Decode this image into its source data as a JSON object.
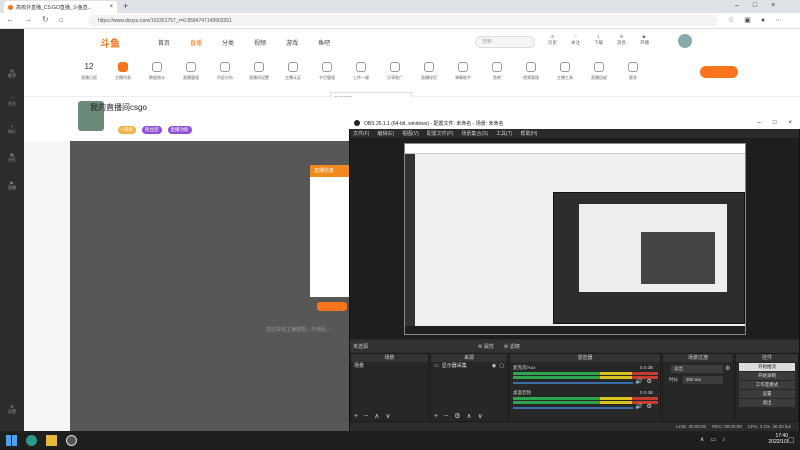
{
  "browser": {
    "tab_title": "高校外直播_CS:GO直播_斗鱼直...",
    "url": "https://www.douyu.com/102351757_r=0.8584747149903261",
    "new_tab": "+"
  },
  "site": {
    "logo": "斗鱼",
    "nav": [
      "首页",
      "直播",
      "分类",
      "视频",
      "游戏",
      "鱼吧"
    ],
    "search_placeholder": "搜索",
    "user_links": [
      "历史",
      "关注",
      "下载",
      "消息",
      "开播"
    ],
    "categories": [
      {
        "label": "直播日程",
        "badge": "12"
      },
      {
        "label": "主播列表"
      },
      {
        "label": "数据统计"
      },
      {
        "label": "直播管理"
      },
      {
        "label": "内容分析"
      },
      {
        "label": "直播间设置"
      },
      {
        "label": "主播认证"
      },
      {
        "label": "节目管理"
      },
      {
        "label": "上传一键"
      },
      {
        "label": "分享推广"
      },
      {
        "label": "直播伴侣"
      },
      {
        "label": "弹幕助手"
      },
      {
        "label": "鱼吧"
      },
      {
        "label": "视频管理"
      },
      {
        "label": "主播工具"
      },
      {
        "label": "直播回放"
      },
      {
        "label": "更多"
      }
    ],
    "notice": "开播提醒",
    "room_title": "我的直播间csgo",
    "room_badges": [
      "V等级",
      "粉丝团",
      "直播功能"
    ],
    "dialog_title": "直播信息",
    "footer_text": "您还没有主播权限，开通后..."
  },
  "sidebar": [
    "推荐",
    "关注",
    "排行",
    "分区",
    "直播",
    "设置"
  ],
  "obs": {
    "title": "OBS 26.1.1 (64-bit, windows) - 配置文件: 未命名 - 场景: 未命名",
    "menu": [
      "文件(F)",
      "编辑(E)",
      "视图(V)",
      "配置文件(P)",
      "场景集合(S)",
      "工具(T)",
      "帮助(H)"
    ],
    "scene_bar_label": "未选源",
    "scene_bar_buttons": [
      "属性",
      "滤镜"
    ],
    "docks": {
      "scenes": {
        "title": "场景",
        "items": [
          "场景"
        ]
      },
      "sources": {
        "title": "来源",
        "items": [
          "显示器采集"
        ]
      },
      "mixer": {
        "title": "混音器",
        "channels": [
          {
            "name": "麦克风/Aux",
            "db": "0.0 dB"
          },
          {
            "name": "桌面音频",
            "db": "0.0 dB"
          }
        ]
      },
      "transitions": {
        "title": "场景过渡",
        "type": "淡出",
        "duration_label": "时长",
        "duration": "300 ms"
      },
      "controls": {
        "title": "控件",
        "buttons": [
          "开始推流",
          "开始录制",
          "工作室模式",
          "设置",
          "退出"
        ]
      }
    },
    "status": {
      "live": "LIVE: 00:00:00",
      "rec": "REC: 00:00:00",
      "cpu": "CPU: 3.1%, 30.00 fps"
    }
  },
  "taskbar": {
    "time": "17:40",
    "date": "2022/1/3"
  }
}
